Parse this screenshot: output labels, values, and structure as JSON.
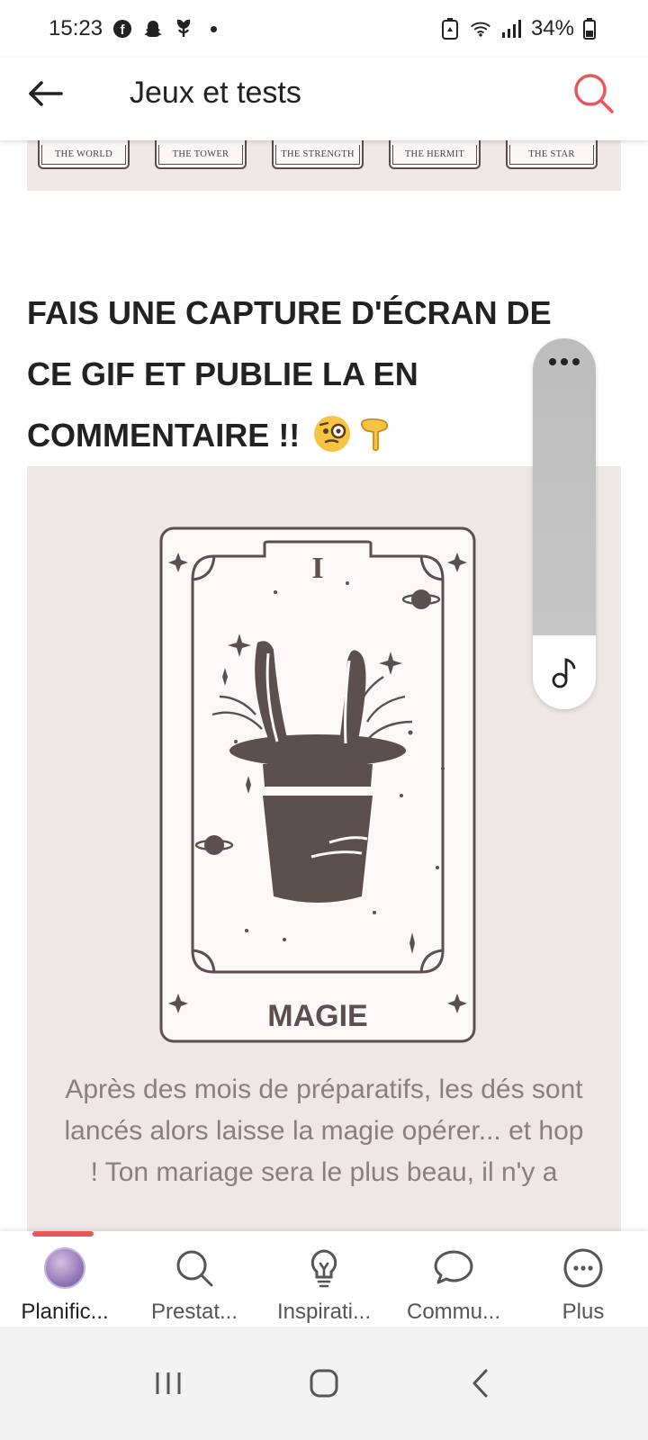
{
  "status_bar": {
    "time": "15:23",
    "battery": "34%",
    "icons": [
      "facebook-icon",
      "snapchat-icon",
      "flower-app-icon",
      "dot-icon",
      "recycle-icon",
      "wifi-icon",
      "signal-icon",
      "battery-icon"
    ]
  },
  "header": {
    "title": "Jeux et tests",
    "back_icon": "arrow-left-icon",
    "search_icon": "search-icon",
    "accent_color": "#e8575c"
  },
  "tarot_strip": {
    "cards": [
      "THE WORLD",
      "THE TOWER",
      "THE STRENGTH",
      "THE HERMIT",
      "THE STAR"
    ]
  },
  "post": {
    "title": "FAIS UNE CAPTURE D'ÉCRAN DE CE GIF ET PUBLIE LA EN COMMENTAIRE !!",
    "emojis": [
      "face-with-monocle-emoji",
      "pointing-down-emoji"
    ]
  },
  "tarot_card": {
    "numeral": "I",
    "name": "MAGIE",
    "caption": "Après des mois de préparatifs, les dés sont lancés alors laisse la magie opérer... et hop ! Ton mariage sera le plus beau, il n'y a"
  },
  "floating_panel": {
    "more_icon": "more-dots-icon",
    "music_icon": "music-note-icon"
  },
  "bottom_nav": {
    "items": [
      {
        "label": "Planific...",
        "icon": "avatar",
        "active": true
      },
      {
        "label": "Prestat...",
        "icon": "search-icon",
        "active": false
      },
      {
        "label": "Inspirati...",
        "icon": "lightbulb-icon",
        "active": false
      },
      {
        "label": "Commu...",
        "icon": "chat-bubble-icon",
        "active": false
      },
      {
        "label": "Plus",
        "icon": "more-circle-icon",
        "active": false
      }
    ]
  },
  "system_nav": {
    "buttons": [
      "recent-apps-icon",
      "home-icon",
      "back-chevron-icon"
    ]
  },
  "colors": {
    "panel_bg": "#efe7e5",
    "card_ink": "#5c504e",
    "caption_text": "#8b7f7d"
  }
}
